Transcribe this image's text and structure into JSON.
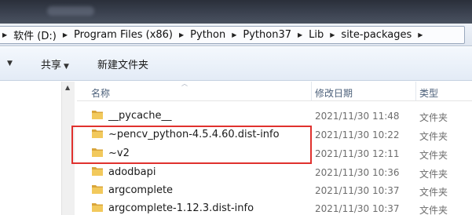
{
  "address": {
    "crumbs": [
      "软件 (D:)",
      "Program Files (x86)",
      "Python",
      "Python37",
      "Lib",
      "site-packages"
    ]
  },
  "toolbar": {
    "share_label": "共享",
    "new_folder_label": "新建文件夹"
  },
  "columns": {
    "name": "名称",
    "modified": "修改日期",
    "type": "类型"
  },
  "rows": [
    {
      "name": "__pycache__",
      "date": "2021/11/30 11:48",
      "type": "文件夹"
    },
    {
      "name": "~pencv_python-4.5.4.60.dist-info",
      "date": "2021/11/30 10:22",
      "type": "文件夹"
    },
    {
      "name": "~v2",
      "date": "2021/11/30 12:11",
      "type": "文件夹"
    },
    {
      "name": "adodbapi",
      "date": "2021/11/30 10:36",
      "type": "文件夹"
    },
    {
      "name": "argcomplete",
      "date": "2021/11/30 10:37",
      "type": "文件夹"
    },
    {
      "name": "argcomplete-1.12.3.dist-info",
      "date": "2021/11/30 10:37",
      "type": "文件夹"
    }
  ],
  "colors": {
    "highlight": "#e0312e",
    "folder": "#e9b94a",
    "column_header": "#4c607a"
  },
  "icons": {
    "folder": "folder-icon",
    "breadcrumb_separator": "chevron-right-icon"
  }
}
